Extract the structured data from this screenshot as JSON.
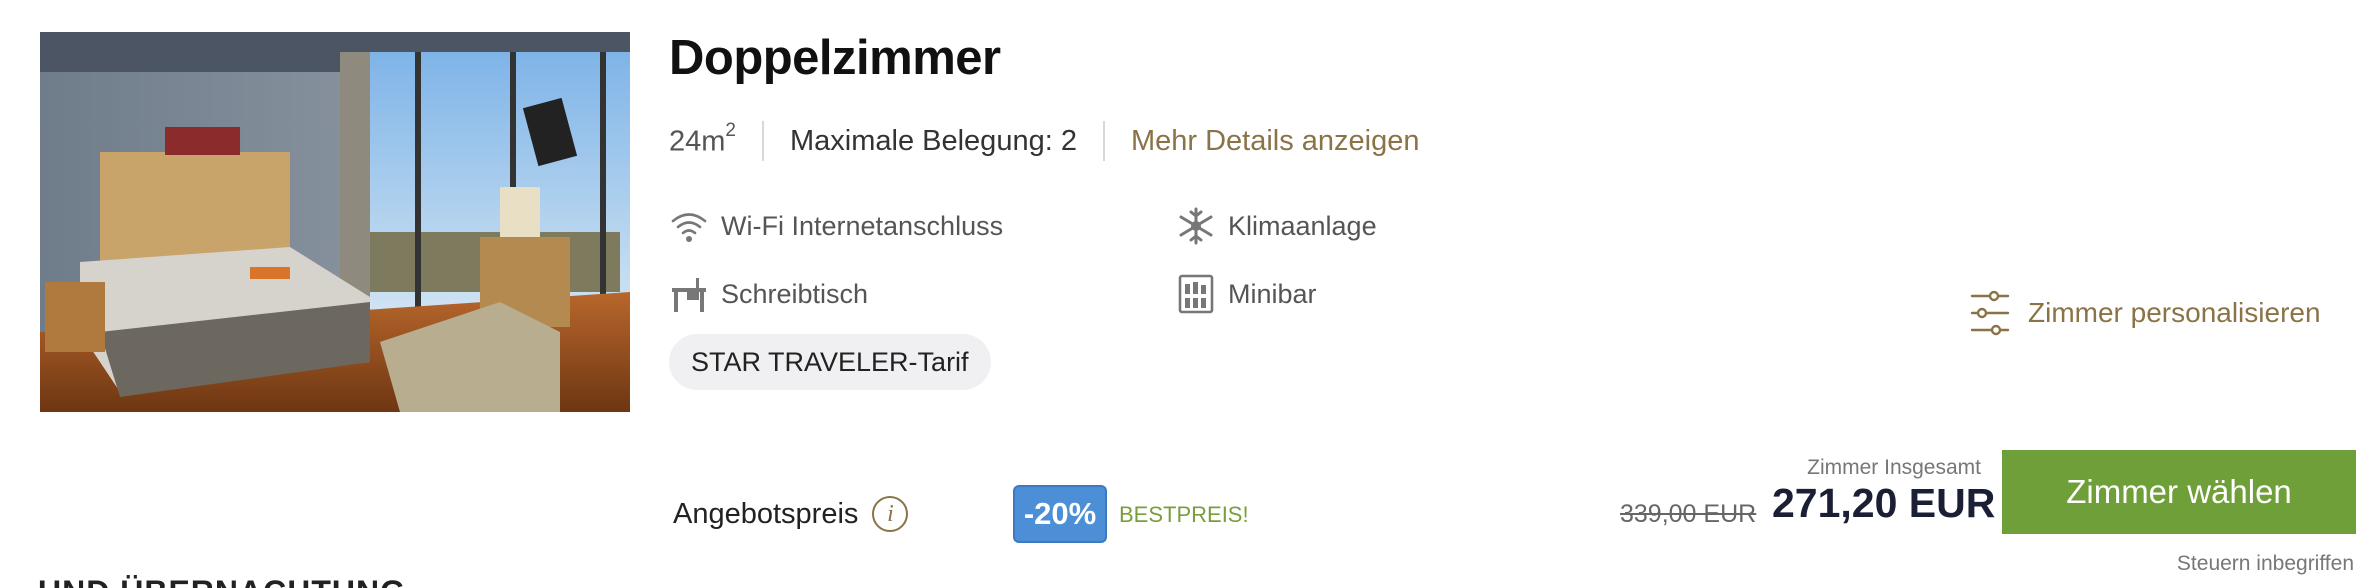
{
  "room": {
    "title": "Doppelzimmer",
    "size_value": "24m",
    "size_sup": "2",
    "occupancy": "Maximale Belegung: 2",
    "details_link": "Mehr Details anzeigen"
  },
  "amenities": [
    {
      "icon": "wifi-icon",
      "label": "Wi-Fi Internetanschluss"
    },
    {
      "icon": "snowflake-icon",
      "label": "Klimaanlage"
    },
    {
      "icon": "desk-icon",
      "label": "Schreibtisch"
    },
    {
      "icon": "minibar-icon",
      "label": "Minibar"
    }
  ],
  "tariff": "STAR TRAVELER-Tarif",
  "personalize_label": "Zimmer personalisieren",
  "offer": {
    "label": "Angebotspreis",
    "info_glyph": "i",
    "discount": "-20%",
    "best_price": "BESTPREIS!",
    "total_label": "Zimmer Insgesamt",
    "old_price": "339,00 EUR",
    "new_price": "271,20 EUR",
    "cta_label": "Zimmer wählen",
    "taxes_note": "Steuern inbegriffen"
  },
  "next_section_heading": "UND ÜBERNACHTUNG",
  "colors": {
    "accent_gold": "#8a7347",
    "cta_green": "#6f9f38",
    "discount_blue": "#4d8fd6",
    "best_green": "#7a9e3c",
    "price_navy": "#1b1f36"
  }
}
